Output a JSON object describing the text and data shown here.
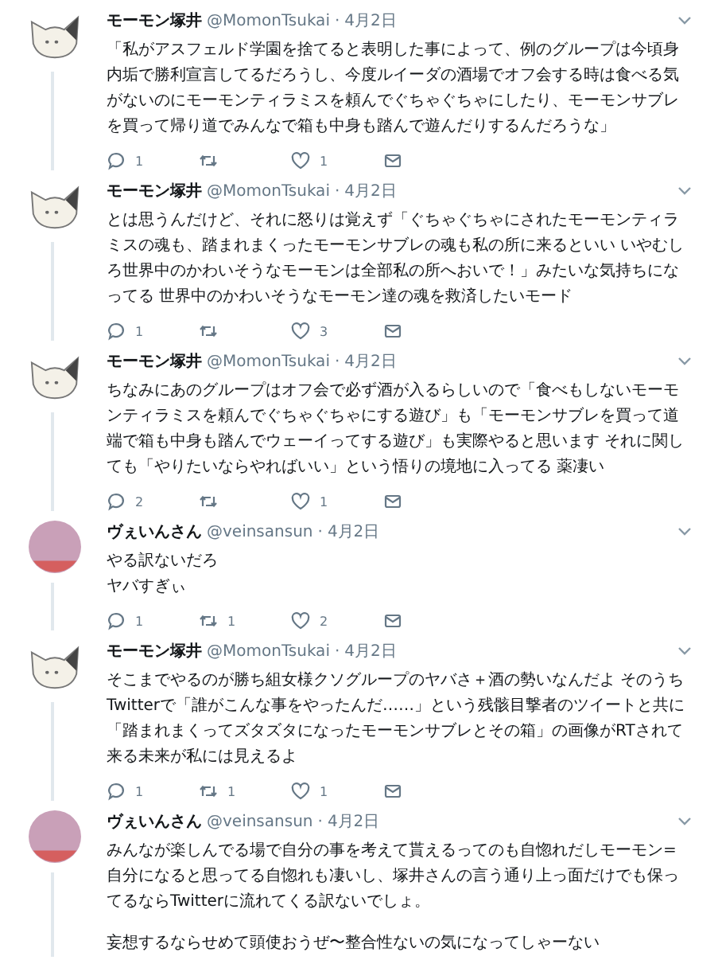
{
  "tweets": [
    {
      "author": {
        "name": "モーモン塚井",
        "handle": "@MomonTsukai",
        "kind": "cat"
      },
      "separator": "·",
      "date": "4月2日",
      "paragraphs": [
        [
          "「私がアスフェルド学園を捨てると表明した事によって、例のグループは今頃身内垢で勝利宣言してるだろうし、今度ルイーダの酒場でオフ会する時は食べる気がないのにモーモンティラミスを頼んでぐちゃぐちゃにしたり、モーモンサブレを買って帰り道でみんなで箱も中身も踏んで遊んだりするんだろうな」"
        ]
      ],
      "replies": "1",
      "likes": "1"
    },
    {
      "author": {
        "name": "モーモン塚井",
        "handle": "@MomonTsukai",
        "kind": "cat"
      },
      "separator": "·",
      "date": "4月2日",
      "paragraphs": [
        [
          "とは思うんだけど、それに怒りは覚えず「ぐちゃぐちゃにされたモーモンティラミスの魂も、踏まれまくったモーモンサブレの魂も私の所に来るといい いやむしろ世界中のかわいそうなモーモンは全部私の所へおいで！」みたいな気持ちになってる 世界中のかわいそうなモーモン達の魂を救済したいモード"
        ]
      ],
      "replies": "1",
      "likes": "3"
    },
    {
      "author": {
        "name": "モーモン塚井",
        "handle": "@MomonTsukai",
        "kind": "cat"
      },
      "separator": "·",
      "date": "4月2日",
      "paragraphs": [
        [
          "ちなみにあのグループはオフ会で必ず酒が入るらしいので「食べもしないモーモンティラミスを頼んでぐちゃぐちゃにする遊び」も「モーモンサブレを買って道端で箱も中身も踏んでウェーイってする遊び」も実際やると思います それに関しても「やりたいならやればいい」という悟りの境地に入ってる 薬凄い"
        ]
      ],
      "replies": "2",
      "likes": "1"
    },
    {
      "author": {
        "name": "ヴぇいんさん",
        "handle": "@veinsansun",
        "kind": "plain"
      },
      "separator": "·",
      "date": "4月2日",
      "paragraphs": [
        [
          "やる訳ないだろ",
          "ヤバすぎぃ"
        ]
      ],
      "replies": "1",
      "retweets": "1",
      "likes": "2"
    },
    {
      "author": {
        "name": "モーモン塚井",
        "handle": "@MomonTsukai",
        "kind": "cat"
      },
      "separator": "·",
      "date": "4月2日",
      "paragraphs": [
        [
          "そこまでやるのが勝ち組女様クソグループのヤバさ＋酒の勢いなんだよ そのうちTwitterで「誰がこんな事をやったんだ……」という残骸目撃者のツイートと共に「踏まれまくってズタズタになったモーモンサブレとその箱」の画像がRTされて来る未来が私には見えるよ"
        ]
      ],
      "replies": "1",
      "retweets": "1",
      "likes": "1"
    },
    {
      "author": {
        "name": "ヴぇいんさん",
        "handle": "@veinsansun",
        "kind": "plain"
      },
      "separator": "·",
      "date": "4月2日",
      "paragraphs": [
        [
          "みんなが楽しんでる場で自分の事を考えて貰えるってのも自惚れだしモーモン=自分になると思ってる自惚れも凄いし、塚井さんの言う通り上っ面だけでも保ってるならTwitterに流れてくる訳ないでしょ。"
        ],
        [
          "妄想するならせめて頭使おうぜ〜整合性ないの気になってしゃーない"
        ]
      ]
    }
  ]
}
